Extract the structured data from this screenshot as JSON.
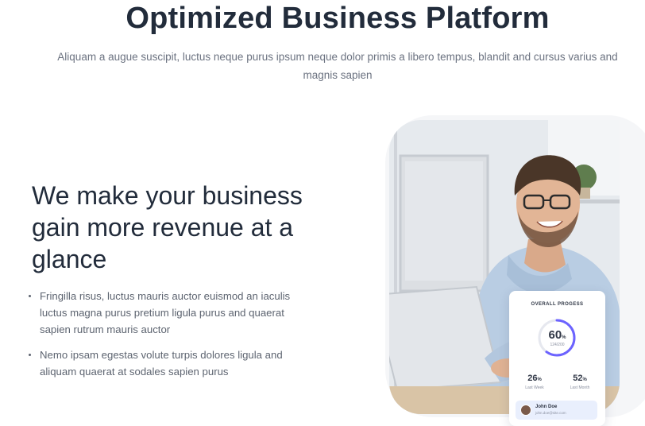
{
  "section": {
    "title": "Optimized Business Platform",
    "subtitle": "Aliquam a augue suscipit, luctus neque purus ipsum neque dolor primis a libero tempus, blandit and cursus varius and magnis sapien"
  },
  "content": {
    "headline": "We make your business gain more revenue at a glance",
    "bullets": [
      "Fringilla risus, luctus mauris auctor euismod an iaculis luctus magna purus pretium ligula purus and quaerat sapien rutrum mauris auctor",
      "Nemo ipsam egestas volute turpis dolores ligula and aliquam quaerat at sodales sapien purus"
    ]
  },
  "progress_card": {
    "title": "OVERALL PROGESS",
    "percent": "60",
    "percent_unit": "%",
    "percent_value": 0.6,
    "detail": "124/200",
    "stats": [
      {
        "value": "26",
        "unit": "%",
        "label": "Last Week"
      },
      {
        "value": "52",
        "unit": "%",
        "label": "Last Month"
      }
    ],
    "user": {
      "name": "John Doe",
      "email": "john.doe@site.com"
    }
  },
  "colors": {
    "accent": "#6c63ff",
    "ring_track": "#e6e8ef"
  }
}
